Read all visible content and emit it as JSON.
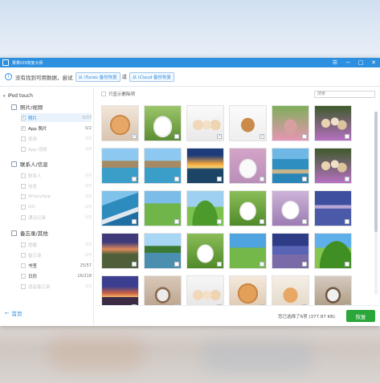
{
  "window": {
    "title": "果果iOS恢复大师"
  },
  "infobar": {
    "text": "没有找到可用数据，尝试",
    "link_itunes": "从 iTunes 备份恢复",
    "or": "或",
    "link_icloud": "从 iCloud 备份恢复"
  },
  "sidebar": {
    "root": "iPod touch",
    "sections": [
      {
        "label": "照片/视频",
        "items": [
          {
            "label": "照片",
            "count": "0/37",
            "state": "sel",
            "checked": true
          },
          {
            "label": "App 照片",
            "count": "0/2",
            "state": "on",
            "checked": true
          },
          {
            "label": "视频",
            "count": "0/0",
            "state": "faded"
          },
          {
            "label": "App 视频",
            "count": "0/0",
            "state": "faded"
          }
        ]
      },
      {
        "label": "联系人/信息",
        "items": [
          {
            "label": "联系人",
            "count": "0/0",
            "state": "faded"
          },
          {
            "label": "信息",
            "count": "0/0",
            "state": "faded"
          },
          {
            "label": "WhatsApp",
            "count": "0/0",
            "state": "faded"
          },
          {
            "label": "QQ",
            "count": "0/0",
            "state": "faded"
          },
          {
            "label": "通话记录",
            "count": "0/0",
            "state": "faded"
          }
        ]
      },
      {
        "label": "备忘录/其他",
        "items": [
          {
            "label": "提醒",
            "count": "0/0",
            "state": "faded"
          },
          {
            "label": "备忘录",
            "count": "0/0",
            "state": "faded"
          },
          {
            "label": "书签",
            "count": "25/57",
            "state": "on"
          },
          {
            "label": "日历",
            "count": "16/218",
            "state": "on"
          },
          {
            "label": "语音备忘录",
            "count": "0/0",
            "state": "faded"
          }
        ]
      }
    ],
    "back": "首页"
  },
  "toolbar": {
    "show_deleted": "只显示删除项",
    "search_placeholder": "搜索"
  },
  "footer": {
    "status": "您已选择了6项 (377.87 KB)",
    "recover": "恢复"
  },
  "thumbnails": [
    {
      "pic": "p-pom",
      "checked": true
    },
    {
      "pic": "p-sam",
      "checked": false
    },
    {
      "pic": "p-pups",
      "checked": true
    },
    {
      "pic": "p-dog",
      "checked": true
    },
    {
      "pic": "p-cat-pink",
      "checked": false
    },
    {
      "pic": "p-kitties",
      "checked": false
    },
    {
      "pic": "p-cliff",
      "checked": false
    },
    {
      "pic": "p-cliff",
      "checked": false
    },
    {
      "pic": "p-sunset",
      "checked": false
    },
    {
      "pic": "p-rabbit",
      "checked": false
    },
    {
      "pic": "p-bay",
      "checked": false
    },
    {
      "pic": "p-kitties",
      "checked": false
    },
    {
      "pic": "p-coast",
      "checked": false
    },
    {
      "pic": "p-hill",
      "checked": false
    },
    {
      "pic": "p-hill2",
      "checked": false
    },
    {
      "pic": "p-sam2",
      "checked": false
    },
    {
      "pic": "p-rabbit2",
      "checked": false
    },
    {
      "pic": "p-lake",
      "checked": false
    },
    {
      "pic": "p-dusk",
      "checked": false
    },
    {
      "pic": "p-river",
      "checked": false
    },
    {
      "pic": "p-sam2",
      "checked": false
    },
    {
      "pic": "p-field",
      "checked": false
    },
    {
      "pic": "p-lake2",
      "checked": false
    },
    {
      "pic": "p-field2",
      "checked": false
    },
    {
      "pic": "p-sky",
      "checked": false
    },
    {
      "pic": "p-calico",
      "checked": false
    },
    {
      "pic": "p-pups2",
      "checked": false
    },
    {
      "pic": "p-pom2",
      "checked": false
    },
    {
      "pic": "p-kitten",
      "checked": false
    },
    {
      "pic": "p-calico2",
      "checked": false
    }
  ],
  "colors": {
    "accent": "#2d8fe0",
    "recover": "#2aa63a"
  }
}
